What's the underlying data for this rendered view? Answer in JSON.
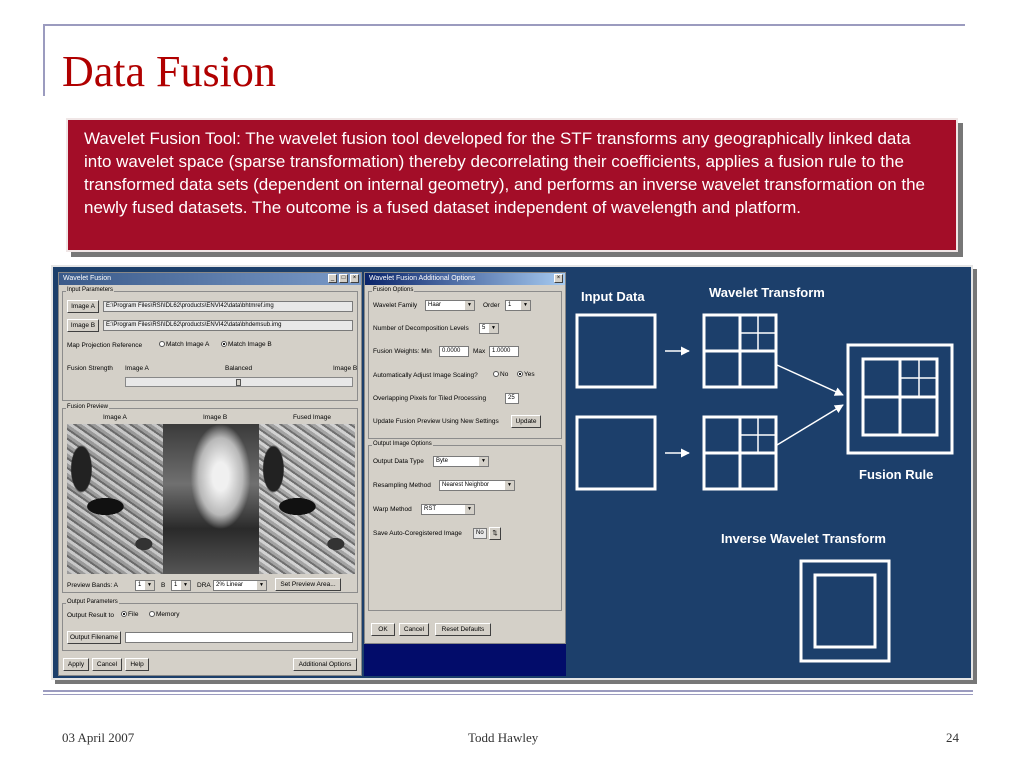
{
  "slide": {
    "title": "Data Fusion",
    "body_text": "Wavelet Fusion Tool:  The wavelet fusion tool developed for the STF transforms any geographically linked data into wavelet space (sparse transformation) thereby decorrelating their coefficients, applies a fusion rule to the transformed data sets (dependent on internal geometry), and performs an inverse wavelet transformation on the newly fused datasets. The outcome is a fused dataset independent of wavelength and platform.",
    "footer": {
      "date": "03 April 2007",
      "author": "Todd Hawley",
      "page": "24"
    }
  },
  "colors": {
    "title": "#b00000",
    "textbox_bg": "#a30d28",
    "figure_bg": "#1c3f6b",
    "window_bg": "#d4d0c8"
  },
  "wavelet_fusion_window": {
    "title": "Wavelet Fusion",
    "input_params": {
      "label": "Input Parameters",
      "image_a_button": "Image A",
      "image_a_path": "E:\\Program Files\\RSI\\IDL62\\products\\ENVI42\\data\\bhtmref.img",
      "image_b_button": "Image B",
      "image_b_path": "E:\\Program Files\\RSI\\IDL62\\products\\ENVI42\\data\\bhdemsub.img",
      "map_projection_label": "Map Projection Reference",
      "match_a": "Match Image A",
      "match_b": "Match Image B",
      "fusion_strength_label": "Fusion Strength",
      "strength_image_a": "Image A",
      "strength_balanced": "Balanced",
      "strength_image_b": "Image B"
    },
    "fusion_preview": {
      "label": "Fusion Preview",
      "image_a": "Image A",
      "image_b": "Image B",
      "fused_image": "Fused Image",
      "preview_bands_label": "Preview Bands:  A",
      "band_a": "1",
      "band_b_label": "B",
      "band_b": "1",
      "dra_label": "DRA",
      "dra_value": "2% Linear",
      "set_preview_button": "Set Preview Area..."
    },
    "output_params": {
      "label": "Output Parameters",
      "output_result_label": "Output Result to",
      "file_option": "File",
      "memory_option": "Memory",
      "output_filename_button": "Output Filename"
    },
    "buttons": {
      "apply": "Apply",
      "cancel": "Cancel",
      "help": "Help",
      "additional": "Additional Options"
    }
  },
  "additional_options_window": {
    "title": "Wavelet Fusion Additional Options",
    "fusion_options": {
      "label": "Fusion Options",
      "wavelet_family_label": "Wavelet Family",
      "wavelet_family": "Haar",
      "order_label": "Order",
      "order": "1",
      "decomp_levels_label": "Number of Decomposition Levels",
      "decomp_levels": "5",
      "weights_label": "Fusion Weights:  Min",
      "weight_min": "0.0000",
      "max_label": "Max",
      "weight_max": "1.0000",
      "auto_adjust_label": "Automatically Adjust Image Scaling?",
      "no_option": "No",
      "yes_option": "Yes",
      "overlap_label": "Overlapping Pixels for Tiled Processing",
      "overlap": "25",
      "update_label": "Update Fusion Preview Using New Settings",
      "update_button": "Update"
    },
    "output_image_options": {
      "label": "Output Image Options",
      "data_type_label": "Output Data Type",
      "data_type": "Byte",
      "resampling_label": "Resampling Method",
      "resampling": "Nearest Neighbor",
      "warp_label": "Warp Method",
      "warp": "RST",
      "save_label": "Save Auto-Coregistered Image",
      "save_value": "No"
    },
    "buttons": {
      "ok": "OK",
      "cancel": "Cancel",
      "reset": "Reset Defaults"
    }
  },
  "diagram": {
    "input_data": "Input Data",
    "wavelet_transform": "Wavelet Transform",
    "fusion_rule": "Fusion Rule",
    "inverse_wavelet_transform": "Inverse Wavelet Transform"
  }
}
